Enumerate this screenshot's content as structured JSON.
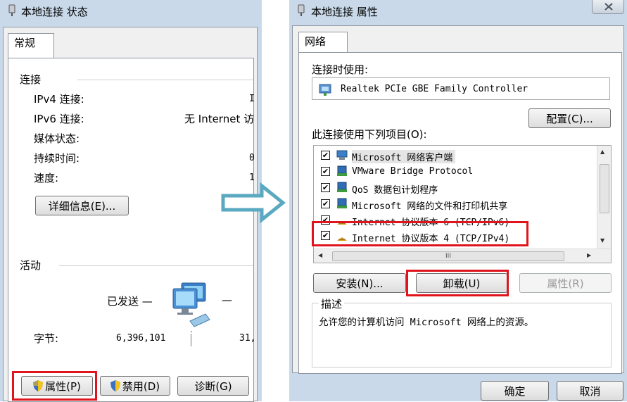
{
  "left": {
    "title": "本地连接 状态",
    "tab": "常规",
    "connection_header": "连接",
    "rows": [
      {
        "label": "IPv4 连接:",
        "value": "I"
      },
      {
        "label": "IPv6 连接:",
        "value": "无 Internet 访"
      },
      {
        "label": "媒体状态:",
        "value": ""
      },
      {
        "label": "持续时间:",
        "value": "0"
      },
      {
        "label": "速度:",
        "value": "1"
      }
    ],
    "details_button": "详细信息(E)...",
    "activity_header": "活动",
    "sent_label": "已发送 —",
    "recv_dash": "—",
    "bytes_label": "字节:",
    "bytes_sent": "6,396,101",
    "bytes_recv": "31,",
    "buttons": {
      "properties": "属性(P)",
      "disable": "禁用(D)",
      "diagnose": "诊断(G)"
    }
  },
  "right": {
    "title": "本地连接 属性",
    "tab": "网络",
    "connect_using_label": "连接时使用:",
    "adapter": "Realtek PCIe GBE Family Controller",
    "configure_button": "配置(C)...",
    "items_label": "此连接使用下列项目(O):",
    "items": [
      {
        "label": "Microsoft 网络客户端",
        "checked": true
      },
      {
        "label": "VMware Bridge Protocol",
        "checked": true
      },
      {
        "label": "QoS 数据包计划程序",
        "checked": true
      },
      {
        "label": "Microsoft 网络的文件和打印机共享",
        "checked": true
      },
      {
        "label": "Internet 协议版本 6 (TCP/IPv6)",
        "checked": true
      },
      {
        "label": "Internet 协议版本 4 (TCP/IPv4)",
        "checked": true
      }
    ],
    "hscroll_thumb": "III",
    "install_button": "安装(N)...",
    "uninstall_button": "卸载(U)",
    "properties_button": "属性(R)",
    "description_label": "描述",
    "description_text": "允许您的计算机访问 Microsoft 网络上的资源。",
    "ok_button": "确定",
    "cancel_button": "取消"
  },
  "colors": {
    "highlight": "#e0141c",
    "arrow": "#5aa9c0",
    "window_frame": "#c9d9ea"
  }
}
